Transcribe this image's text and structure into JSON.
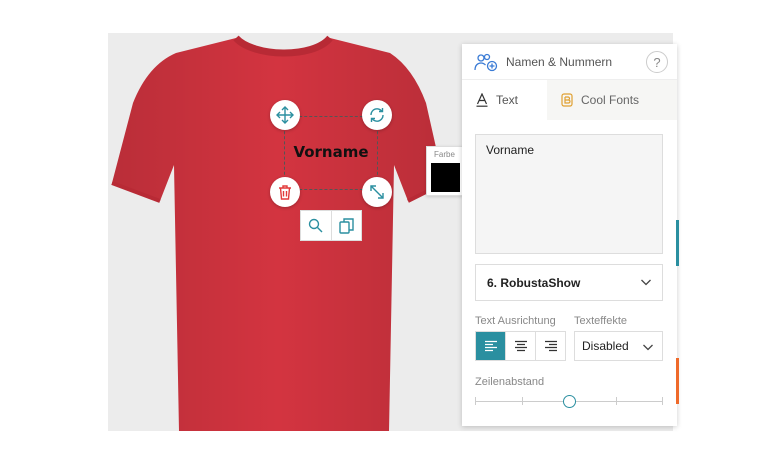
{
  "colors": {
    "shirt": "#d33440",
    "accent": "#2a8fa0",
    "delete": "#e23a3a",
    "swatch": "#000000",
    "edge_orange": "#ef6a2a"
  },
  "design": {
    "text": "Vorname"
  },
  "handles": {
    "move": "move-arrows-icon",
    "rotate": "rotate-icon",
    "delete": "trash-icon",
    "resize": "resize-diagonal-icon"
  },
  "mini_toolbar": {
    "zoom": "zoom-icon",
    "duplicate": "duplicate-icon"
  },
  "color_picker": {
    "label": "Farbe"
  },
  "panel": {
    "header_title": "Namen & Nummern",
    "help": "?",
    "tabs": [
      {
        "label": "Text",
        "icon": "text-icon",
        "active": true
      },
      {
        "label": "Cool Fonts",
        "icon": "cool-fonts-icon",
        "active": false
      }
    ],
    "text_value": "Vorname",
    "font": "6. RobustaShow",
    "align_label": "Text Ausrichtung",
    "effects_label": "Texteffekte",
    "align_options": [
      "left",
      "center",
      "right"
    ],
    "align_selected": "left",
    "effects_value": "Disabled",
    "spacing_label": "Zeilenabstand",
    "spacing_level": 0.5
  }
}
